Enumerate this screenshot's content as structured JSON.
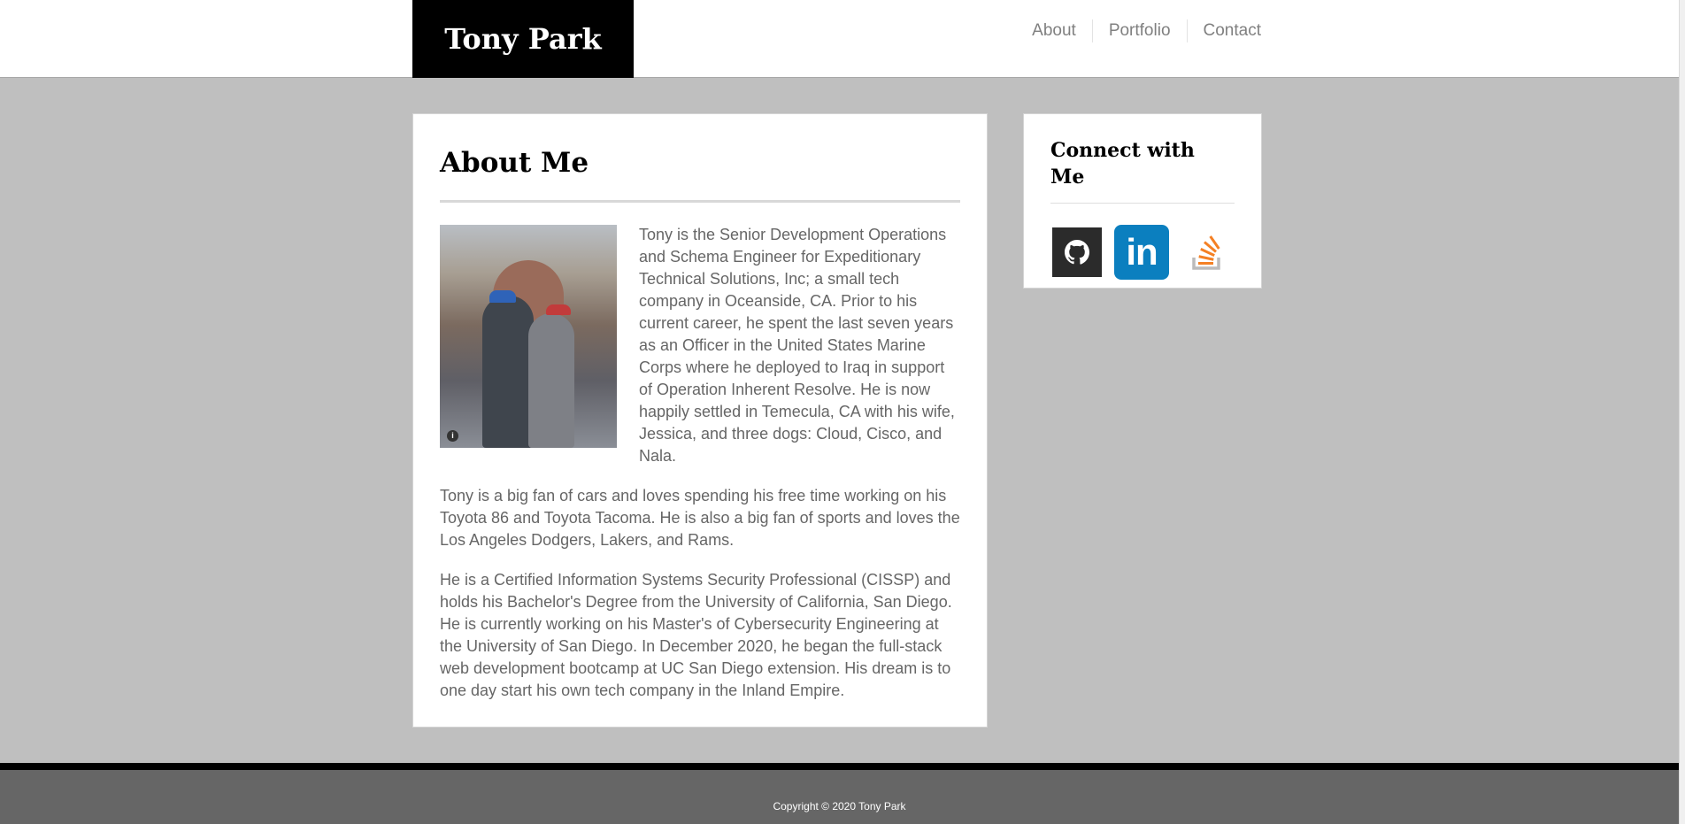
{
  "header": {
    "brand": "Tony Park",
    "nav": [
      "About",
      "Portfolio",
      "Contact"
    ]
  },
  "about": {
    "title": "About Me",
    "paragraphs": [
      "Tony is the Senior Development Operations and Schema Engineer for Expeditionary Technical Solutions, Inc; a small tech company in Oceanside, CA. Prior to his current career, he spent the last seven years as an Officer in the United States Marine Corps where he deployed to Iraq in support of Operation Inherent Resolve. He is now happily settled in Temecula, CA with his wife, Jessica, and three dogs: Cloud, Cisco, and Nala.",
      "Tony is a big fan of cars and loves spending his free time working on his Toyota 86 and Toyota Tacoma. He is also a big fan of sports and loves the Los Angeles Dodgers, Lakers, and Rams.",
      "He is a Certified Information Systems Security Professional (CISSP) and holds his Bachelor's Degree from the University of California, San Diego. He is currently working on his Master's of Cybersecurity Engineering at the University of San Diego. In December 2020, he began the full-stack web development bootcamp at UC San Diego extension. His dream is to one day start his own tech company in the Inland Empire."
    ]
  },
  "sidebar": {
    "title": "Connect with Me",
    "icons": [
      "github-icon",
      "linkedin-icon",
      "stackoverflow-icon"
    ],
    "linkedin_text": "in"
  },
  "footer": {
    "copyright": "Copyright © 2020 Tony Park"
  },
  "colors": {
    "background": "#bfbfbf",
    "brand_bg": "#000000",
    "linkedin": "#0b7fbf",
    "stackoverflow": "#f48024",
    "footer": "#666666"
  }
}
